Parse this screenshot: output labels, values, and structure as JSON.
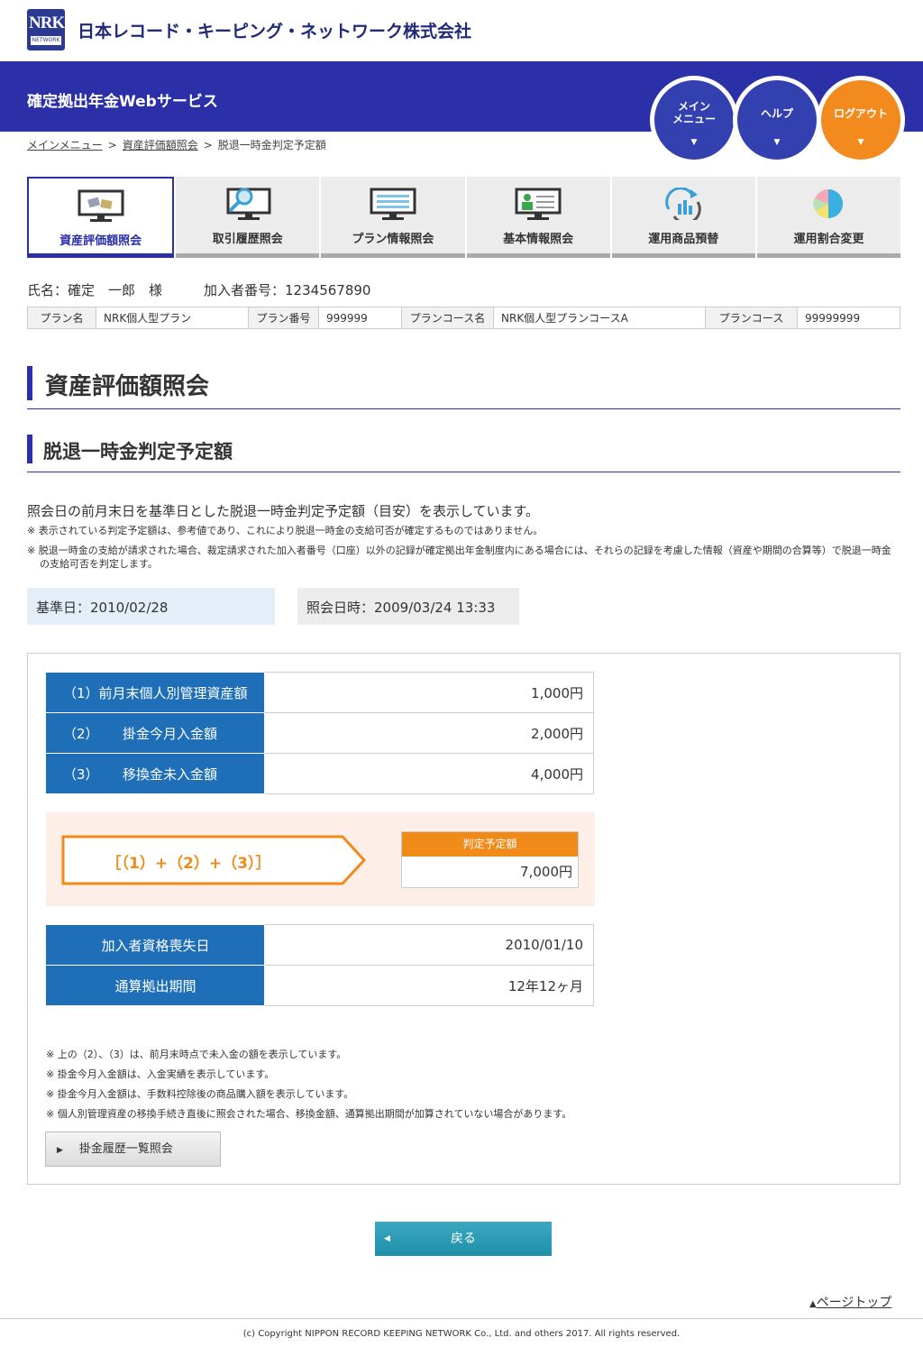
{
  "header": {
    "logo_main": "NRK",
    "logo_sub": "NETWORK",
    "company": "日本レコード・キーピング・ネットワーク株式会社",
    "service": "確定拠出年金Webサービス",
    "buttons": [
      {
        "label": "メイン\nメニュー",
        "color": "#3340b0"
      },
      {
        "label": "ヘルプ",
        "color": "#3340b0"
      },
      {
        "label": "ログアウト",
        "color": "#f28a1e"
      }
    ]
  },
  "breadcrumb": {
    "items": [
      "メインメニュー",
      "資産評価額照会",
      "脱退一時金判定予定額"
    ],
    "separator": ">"
  },
  "tabs": [
    {
      "label": "資産評価額照会",
      "icon": "monitor-money-icon",
      "active": true
    },
    {
      "label": "取引履歴照会",
      "icon": "monitor-search-icon",
      "active": false
    },
    {
      "label": "プラン情報照会",
      "icon": "monitor-list-icon",
      "active": false
    },
    {
      "label": "基本情報照会",
      "icon": "monitor-person-icon",
      "active": false
    },
    {
      "label": "運用商品預替",
      "icon": "refresh-chart-icon",
      "active": false
    },
    {
      "label": "運用割合変更",
      "icon": "pie-chart-icon",
      "active": false
    }
  ],
  "user": {
    "name": "氏名：確定　一郎　様",
    "member_no": "加入者番号：1234567890"
  },
  "plan": {
    "plan_name_label": "プラン名",
    "plan_name": "NRK個人型プラン",
    "plan_no_label": "プラン番号",
    "plan_no": "999999",
    "course_name_label": "プランコース名",
    "course_name": "NRK個人型プランコースA",
    "course_label": "プランコース",
    "course": "99999999"
  },
  "page_title": "資産評価額照会",
  "section_title": "脱退一時金判定予定額",
  "description": "照会日の前月末日を基準日とした脱退一時金判定予定額（目安）を表示しています。",
  "notes_top": [
    "※ 表示されている判定予定額は、参考値であり、これにより脱退一時金の支給可否が確定するものではありません。",
    "※ 脱退一時金の支給が請求された場合、裁定請求された加入者番号（口座）以外の記録が確定拠出年金制度内にある場合には、それらの記録を考慮した情報（資産や期間の合算等）で脱退一時金の支給可否を判定します。"
  ],
  "dates": {
    "base": "基準日：2010/02/28",
    "query": "照会日時：2009/03/24 13:33"
  },
  "amounts": [
    {
      "num": "（1）",
      "label": "前月末個人別管理資産額",
      "value": "1,000円"
    },
    {
      "num": "（2）",
      "label": "掛金今月入金額",
      "value": "2,000円"
    },
    {
      "num": "（3）",
      "label": "移換金未入金額",
      "value": "4,000円"
    }
  ],
  "formula": "［（1）+（2）+（3）］",
  "judge": {
    "label": "判定予定額",
    "value": "7,000円"
  },
  "info": [
    {
      "label": "加入者資格喪失日",
      "value": "2010/01/10"
    },
    {
      "label": "通算拠出期間",
      "value": "12年12ヶ月"
    }
  ],
  "notes_bottom": [
    "※ 上の（2）、（3）は、前月末時点で未入金の額を表示しています。",
    "※ 掛金今月入金額は、入金実績を表示しています。",
    "※ 掛金今月入金額は、手数料控除後の商品購入額を表示しています。",
    "※ 個人別管理資産の移換手続き直後に照会された場合、移換金額、通算拠出期間が加算されていない場合があります。"
  ],
  "history_button": "掛金履歴一覧照会",
  "back_button": "戻る",
  "page_top": "ページトップ",
  "copyright": "(c) Copyright NIPPON RECORD KEEPING NETWORK Co., Ltd. and others 2017. All rights reserved."
}
